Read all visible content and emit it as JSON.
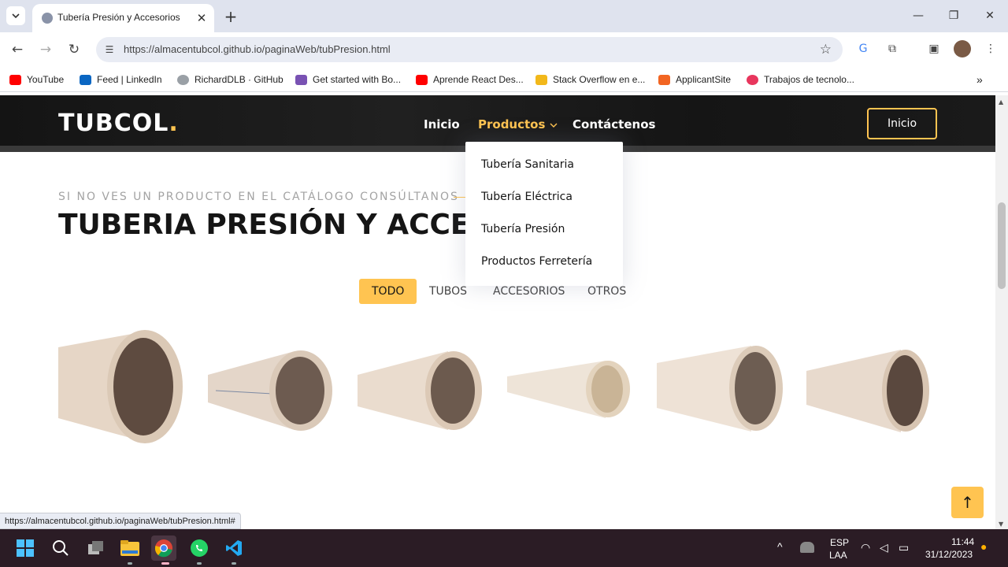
{
  "browser": {
    "tab_title": "Tubería Presión y Accesorios",
    "url": "https://almacentubcol.github.io/paginaWeb/tubPresion.html",
    "status_url": "https://almacentubcol.github.io/paginaWeb/tubPresion.html#",
    "bookmarks": [
      {
        "label": "YouTube",
        "icon": "youtube-icon",
        "color": "#ff0000"
      },
      {
        "label": "Feed | LinkedIn",
        "icon": "linkedin-icon",
        "color": "#0a66c2"
      },
      {
        "label": "RichardDLB · GitHub",
        "icon": "github-icon",
        "color": "#9aa0a6"
      },
      {
        "label": "Get started with Bo...",
        "icon": "bootstrap-icon",
        "color": "#7952b3"
      },
      {
        "label": "Aprende React Des...",
        "icon": "youtube-icon",
        "color": "#ff0000"
      },
      {
        "label": "Stack Overflow en e...",
        "icon": "stackoverflow-icon",
        "color": "#f2b81a"
      },
      {
        "label": "ApplicantSite",
        "icon": "applicantsite-icon",
        "color": "#f26522"
      },
      {
        "label": "Trabajos de tecnolo...",
        "icon": "jobs-icon",
        "color": "#e8365d"
      }
    ]
  },
  "site": {
    "logo": "TUBCOL",
    "logo_dot": ".",
    "nav": {
      "inicio": "Inicio",
      "productos": "Productos",
      "contactenos": "Contáctenos"
    },
    "header_button": "Inicio",
    "dropdown": [
      "Tubería Sanitaria",
      "Tubería Eléctrica",
      "Tubería Presión",
      "Productos Ferretería"
    ],
    "subtitle": "SI NO VES UN PRODUCTO EN EL CATÁLOGO CONSÚLTANOS",
    "heading": "TUBERIA PRESIÓN Y ACCESORIOS",
    "filters": [
      "TODO",
      "TUBOS",
      "ACCESORIOS",
      "OTROS"
    ],
    "active_filter": "TODO",
    "accent_color": "#ffc451"
  },
  "taskbar": {
    "lang_top": "ESP",
    "lang_bottom": "LAA",
    "time": "11:44",
    "date": "31/12/2023"
  }
}
